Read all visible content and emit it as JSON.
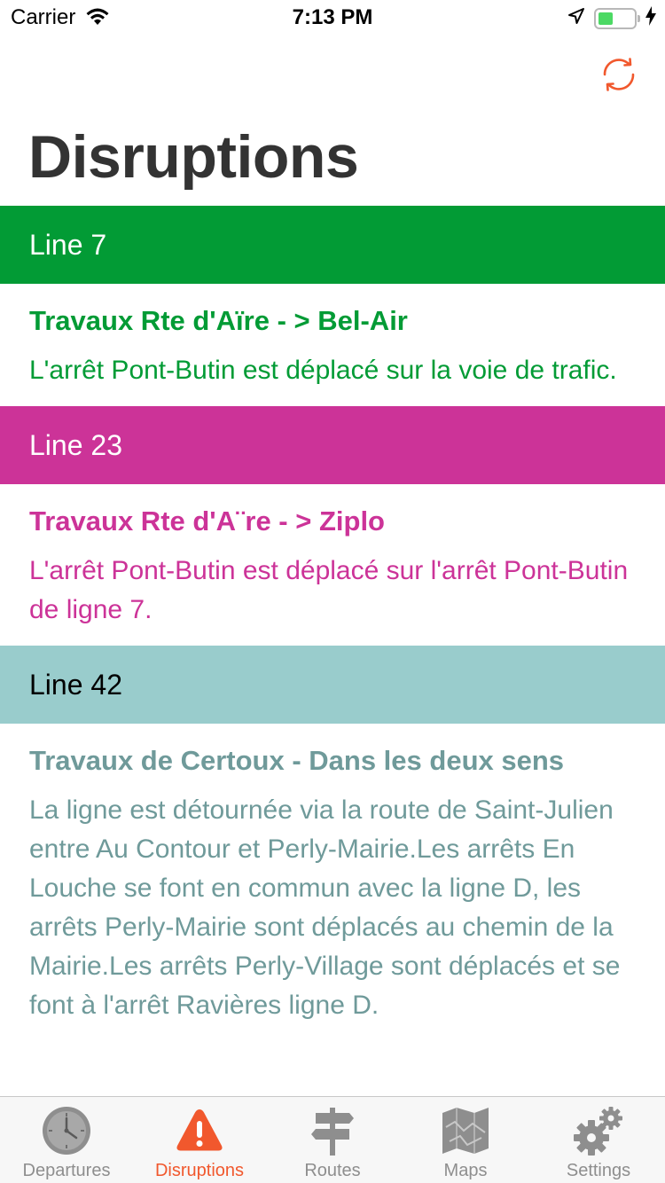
{
  "status_bar": {
    "carrier": "Carrier",
    "time": "7:13 PM"
  },
  "nav": {
    "title": "Disruptions",
    "refresh_icon": "refresh-icon"
  },
  "sections": [
    {
      "header": "Line 7",
      "header_bg": "#029b35",
      "header_fg": "#ffffff",
      "text_color": "#029b35",
      "title": "Travaux Rte d'Aïre - > Bel-Air",
      "text": "L'arrêt Pont-Butin est déplacé sur la voie de trafic."
    },
    {
      "header": "Line 23",
      "header_bg": "#cc3398",
      "header_fg": "#ffffff",
      "text_color": "#cc3398",
      "title": "Travaux Rte d'A¨re - > Ziplo",
      "text": "L'arrêt Pont-Butin est déplacé sur l'arrêt Pont-Butin de ligne 7."
    },
    {
      "header": "Line 42",
      "header_bg": "#99cccc",
      "header_fg": "#000000",
      "text_color": "#6f9a9a",
      "title": "Travaux de Certoux - Dans les deux sens",
      "text": "La ligne est détournée via la route de Saint-Julien entre Au Contour et Perly-Mairie.Les arrêts En Louche se font en commun avec la ligne D, les arrêts Perly-Mairie sont déplacés au chemin de la Mairie.Les arrêts Perly-Village sont déplacés et se font à l'arrêt Ravières ligne D."
    }
  ],
  "tabs": [
    {
      "label": "Departures",
      "icon": "clock-icon",
      "active": false
    },
    {
      "label": "Disruptions",
      "icon": "warning-icon",
      "active": true
    },
    {
      "label": "Routes",
      "icon": "signpost-icon",
      "active": false
    },
    {
      "label": "Maps",
      "icon": "map-icon",
      "active": false
    },
    {
      "label": "Settings",
      "icon": "gear-icon",
      "active": false
    }
  ],
  "colors": {
    "accent": "#f1582d",
    "tab_inactive": "#8e8e8e",
    "title": "#333333"
  }
}
